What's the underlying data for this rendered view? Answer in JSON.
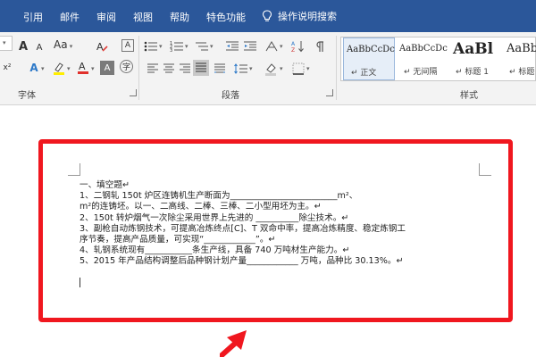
{
  "menubar": {
    "tabs": [
      "",
      "引用",
      "邮件",
      "审阅",
      "视图",
      "帮助",
      "特色功能"
    ],
    "tellme": "操作说明搜索"
  },
  "ribbon": {
    "font_group_label": "字体",
    "paragraph_group_label": "段落",
    "styles_group_label": "样式",
    "font_size_partial": "a",
    "aa_label": "Aa",
    "styles": [
      {
        "sample": "AaBbCcDc",
        "name": "正文"
      },
      {
        "sample": "AaBbCcDc",
        "name": "无间隔"
      },
      {
        "sample": "AaBl",
        "name": "标题 1"
      },
      {
        "sample": "AaBb",
        "name": "标题"
      }
    ]
  },
  "document": {
    "lines": [
      "一、填空题↵",
      "1、二钢轧 150t 炉区连铸机生产断面为_________________________m²、",
      "m²的连铸坯。以一、二高线、二棒、三棒、二小型用坯为主。↵",
      "2、150t 转炉烟气一次除尘采用世界上先进的 __________除尘技术。↵",
      "3、副枪自动炼钢技术，可提高冶炼终点[C]、T 双命中率，提高冶炼精度、稳定炼钢工",
      "序节奏，提高产品质量，可实现“____________”。↵",
      "4、轧钢系统现有___________条生产线，具备 740 万吨材生产能力。↵",
      "5、2015 年产品结构调整后品种钢计划产量____________ 万吨，品种比 30.13%。↵"
    ]
  },
  "colors": {
    "menubar": "#2b579a",
    "highlight": "#f0171f",
    "ribbon": "#f3f3f3"
  }
}
